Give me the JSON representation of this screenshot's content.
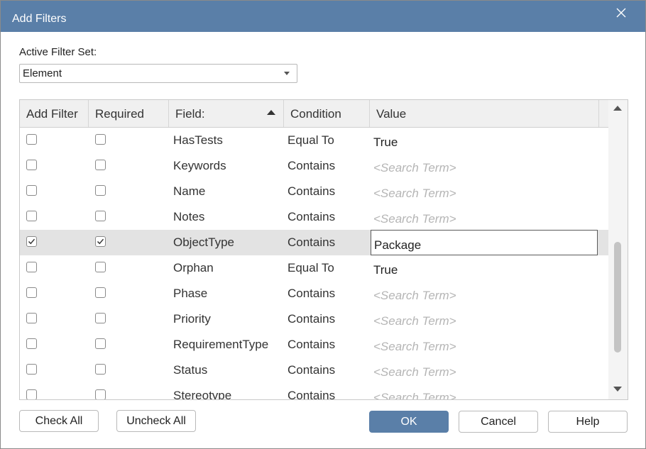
{
  "window": {
    "title": "Add Filters"
  },
  "active_filter_set": {
    "label": "Active Filter Set:",
    "selected": "Element"
  },
  "grid": {
    "columns": [
      "Add Filter",
      "Required",
      "Field:",
      "Condition",
      "Value"
    ],
    "rows": [
      {
        "add": false,
        "required": false,
        "field": "HasTests",
        "condition": "Equal To",
        "value": "True",
        "placeholder": false,
        "selected": false
      },
      {
        "add": false,
        "required": false,
        "field": "Keywords",
        "condition": "Contains",
        "value": "<Search Term>",
        "placeholder": true,
        "selected": false
      },
      {
        "add": false,
        "required": false,
        "field": "Name",
        "condition": "Contains",
        "value": "<Search Term>",
        "placeholder": true,
        "selected": false
      },
      {
        "add": false,
        "required": false,
        "field": "Notes",
        "condition": "Contains",
        "value": "<Search Term>",
        "placeholder": true,
        "selected": false
      },
      {
        "add": true,
        "required": true,
        "field": "ObjectType",
        "condition": "Contains",
        "value": "Package",
        "placeholder": false,
        "selected": true
      },
      {
        "add": false,
        "required": false,
        "field": "Orphan",
        "condition": "Equal To",
        "value": "True",
        "placeholder": false,
        "selected": false
      },
      {
        "add": false,
        "required": false,
        "field": "Phase",
        "condition": "Contains",
        "value": "<Search Term>",
        "placeholder": true,
        "selected": false
      },
      {
        "add": false,
        "required": false,
        "field": "Priority",
        "condition": "Contains",
        "value": "<Search Term>",
        "placeholder": true,
        "selected": false
      },
      {
        "add": false,
        "required": false,
        "field": "RequirementType",
        "condition": "Contains",
        "value": "<Search Term>",
        "placeholder": true,
        "selected": false
      },
      {
        "add": false,
        "required": false,
        "field": "Status",
        "condition": "Contains",
        "value": "<Search Term>",
        "placeholder": true,
        "selected": false
      },
      {
        "add": false,
        "required": false,
        "field": "Stereotype",
        "condition": "Contains",
        "value": "<Search Term>",
        "placeholder": true,
        "selected": false
      }
    ]
  },
  "buttons": {
    "check_all": "Check All",
    "uncheck_all": "Uncheck All",
    "ok": "OK",
    "cancel": "Cancel",
    "help": "Help"
  },
  "colors": {
    "titlebar": "#5a7fa8",
    "primary_button": "#5a7fa8",
    "placeholder": "#b5b5b5"
  }
}
